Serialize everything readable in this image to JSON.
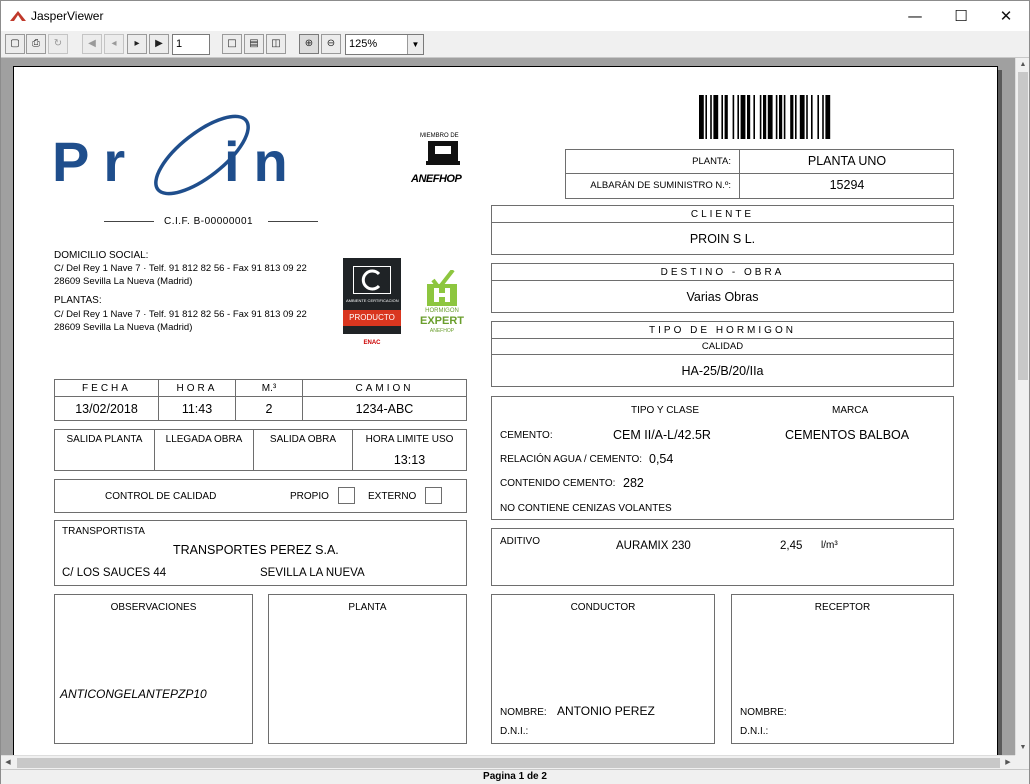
{
  "window": {
    "title": "JasperViewer"
  },
  "toolbar": {
    "page_number": "1",
    "zoom": "125%"
  },
  "status": {
    "page_indicator": "Pagina 1 de 2"
  },
  "company": {
    "logo_text": "PROIN",
    "cif": "C.I.F.  B-00000001",
    "member_label": "MIEMBRO DE",
    "member_name": "ANEFHOP",
    "domicilio_title": "DOMICILIO SOCIAL:",
    "domicilio_line1": "C/ Del Rey 1 Nave 7 · Telf. 91 812 82 56 - Fax 91 813 09 22",
    "domicilio_line2": "28609 Sevilla La Nueva (Madrid)",
    "plantas_title": "PLANTAS:",
    "plantas_line1": "C/ Del Rey 1 Nave 7 · Telf. 91 812 82 56 - Fax 91 813 09 22",
    "plantas_line2": "28609 Sevilla La Nueva (Madrid)",
    "cert_badge_top": "AMBIENTE CERTIFICACION",
    "cert_badge_label": "PRODUCTO",
    "cert_badge_bottom": "ENAC",
    "expert_badge_line1": "HORMIGON",
    "expert_badge_line2": "EXPERT",
    "expert_badge_line3": "ANEFHOP"
  },
  "header": {
    "planta_label": "PLANTA:",
    "planta_value": "PLANTA UNO",
    "albaran_label": "ALBARÁN DE SUMINISTRO N.º:",
    "albaran_value": "15294"
  },
  "cliente": {
    "title": "CLIENTE",
    "value": "PROIN S L."
  },
  "destino": {
    "title": "DESTINO - OBRA",
    "value": "Varias Obras"
  },
  "hormigon": {
    "title": "TIPO DE HORMIGON",
    "calidad_label": "CALIDAD",
    "calidad_value": "HA-25/B/20/IIa"
  },
  "composition": {
    "tipo_header": "TIPO Y CLASE",
    "marca_header": "MARCA",
    "cemento_label": "CEMENTO:",
    "cemento_tipo": "CEM II/A-L/42.5R",
    "cemento_marca": "CEMENTOS BALBOA",
    "relacion_label": "RELACIÓN AGUA / CEMENTO:",
    "relacion_value": "0,54",
    "contenido_label": "CONTENIDO CEMENTO:",
    "contenido_value": "282",
    "cenizas_note": "NO CONTIENE CENIZAS VOLANTES"
  },
  "aditivo": {
    "label": "ADITIVO",
    "name": "AURAMIX 230",
    "amount": "2,45",
    "unit": "l/m³"
  },
  "delivery": {
    "fecha_label": "FECHA",
    "fecha_value": "13/02/2018",
    "hora_label": "HORA",
    "hora_value": "11:43",
    "m3_label": "M.³",
    "m3_value": "2",
    "camion_label": "CAMION",
    "camion_value": "1234-ABC"
  },
  "times": {
    "salida_planta_label": "SALIDA PLANTA",
    "llegada_obra_label": "LLEGADA OBRA",
    "salida_obra_label": "SALIDA OBRA",
    "hora_limite_label": "HORA LIMITE USO",
    "hora_limite_value": "13:13"
  },
  "control": {
    "label": "CONTROL DE CALIDAD",
    "propio_label": "PROPIO",
    "externo_label": "EXTERNO"
  },
  "transportista": {
    "label": "TRANSPORTISTA",
    "name": "TRANSPORTES PEREZ S.A.",
    "address": "C/ LOS SAUCES 44",
    "city": "SEVILLA LA NUEVA"
  },
  "observaciones": {
    "title": "OBSERVACIONES",
    "value": "ANTICONGELANTEPZP10"
  },
  "planta_box": {
    "title": "PLANTA"
  },
  "conductor": {
    "title": "CONDUCTOR",
    "nombre_label": "NOMBRE:",
    "nombre_value": "ANTONIO PEREZ",
    "dni_label": "D.N.I.:"
  },
  "receptor": {
    "title": "RECEPTOR",
    "nombre_label": "NOMBRE:",
    "dni_label": "D.N.I.:"
  },
  "colors": {
    "logo_blue": "#1f4e8c",
    "badge_green": "#8dc63f",
    "badge_red": "#d9361f"
  }
}
